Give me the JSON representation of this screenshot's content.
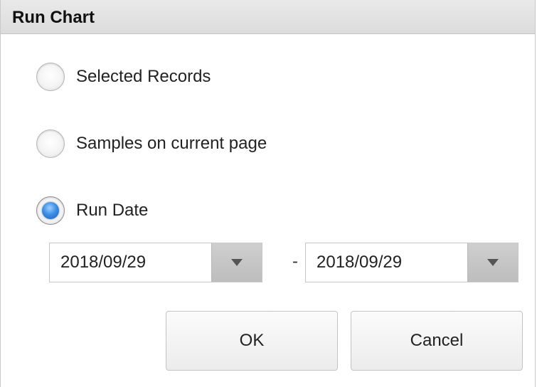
{
  "dialog": {
    "title": "Run Chart"
  },
  "options": {
    "selected_records": {
      "label": "Selected Records",
      "checked": false
    },
    "samples_on_page": {
      "label": "Samples on current page",
      "checked": false
    },
    "run_date": {
      "label": "Run Date",
      "checked": true
    }
  },
  "date_range": {
    "from": "2018/09/29",
    "separator": "-",
    "to": "2018/09/29"
  },
  "buttons": {
    "ok": "OK",
    "cancel": "Cancel"
  },
  "icons": {
    "dropdown": "chevron-down-icon",
    "radio_checked_color": "#3c8fe6"
  }
}
